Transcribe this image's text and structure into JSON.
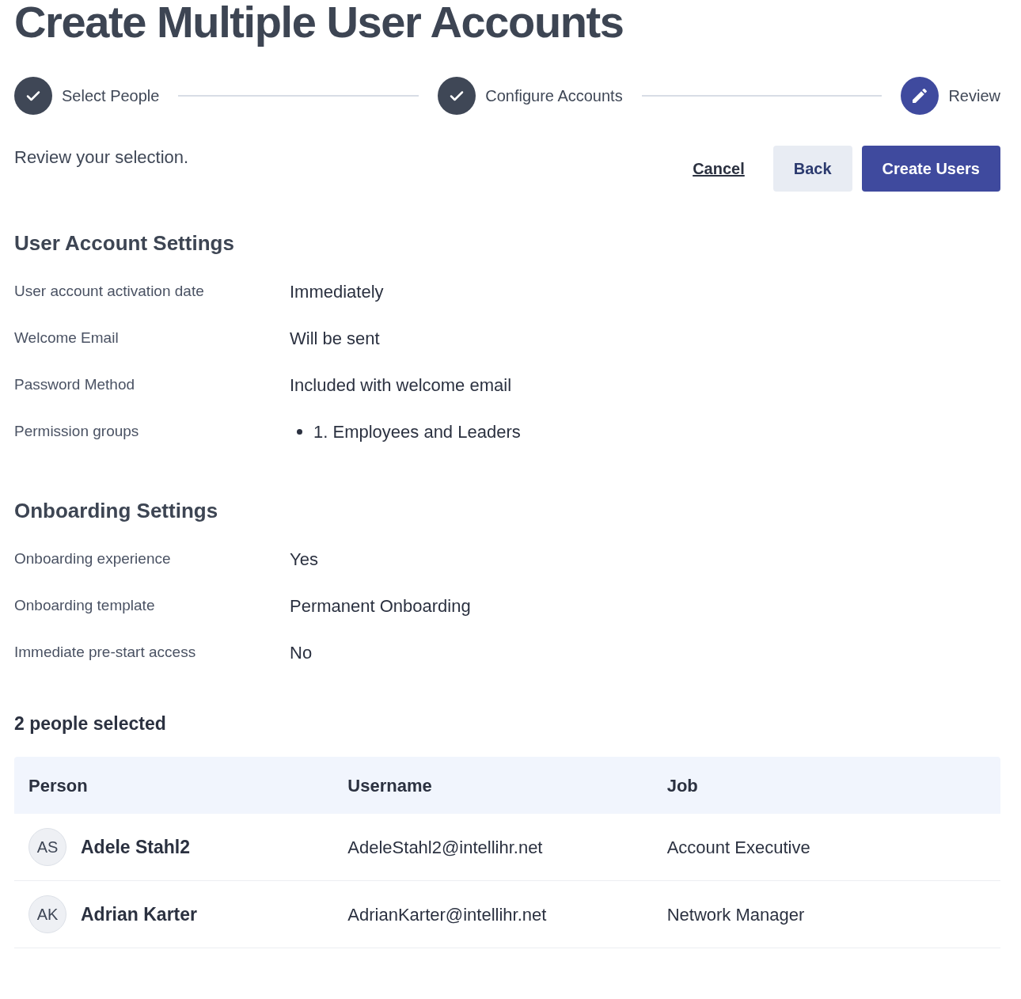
{
  "title": "Create Multiple User Accounts",
  "steps": [
    {
      "label": "Select People",
      "complete": true,
      "selected": false
    },
    {
      "label": "Configure Accounts",
      "complete": true,
      "selected": false
    },
    {
      "label": "Review",
      "complete": false,
      "selected": true
    }
  ],
  "instruction": "Review your selection.",
  "actions": {
    "cancel": "Cancel",
    "back": "Back",
    "primary": "Create Users"
  },
  "sections": [
    {
      "heading": "User Account Settings",
      "rows": [
        {
          "label": "User account activation date",
          "kind": "text",
          "value": "Immediately"
        },
        {
          "label": "Welcome Email",
          "kind": "text",
          "value": "Will be sent"
        },
        {
          "label": "Password Method",
          "kind": "text",
          "value": "Included with welcome email"
        },
        {
          "label": "Permission groups",
          "kind": "list",
          "items": [
            "1. Employees and Leaders"
          ]
        }
      ]
    },
    {
      "heading": "Onboarding Settings",
      "rows": [
        {
          "label": "Onboarding experience",
          "kind": "text",
          "value": "Yes"
        },
        {
          "label": "Onboarding template",
          "kind": "text",
          "value": "Permanent Onboarding"
        },
        {
          "label": "Immediate pre-start access",
          "kind": "text",
          "value": "No"
        }
      ]
    }
  ],
  "selected_count": "2 people selected",
  "table": {
    "columns": [
      "Person",
      "Username",
      "Job"
    ],
    "rows": [
      {
        "initials": "AS",
        "name": "Adele Stahl2",
        "username": "AdeleStahl2@intellihr.net",
        "job": "Account Executive"
      },
      {
        "initials": "AK",
        "name": "Adrian Karter",
        "username": "AdrianKarter@intellihr.net",
        "job": "Network Manager"
      }
    ]
  }
}
